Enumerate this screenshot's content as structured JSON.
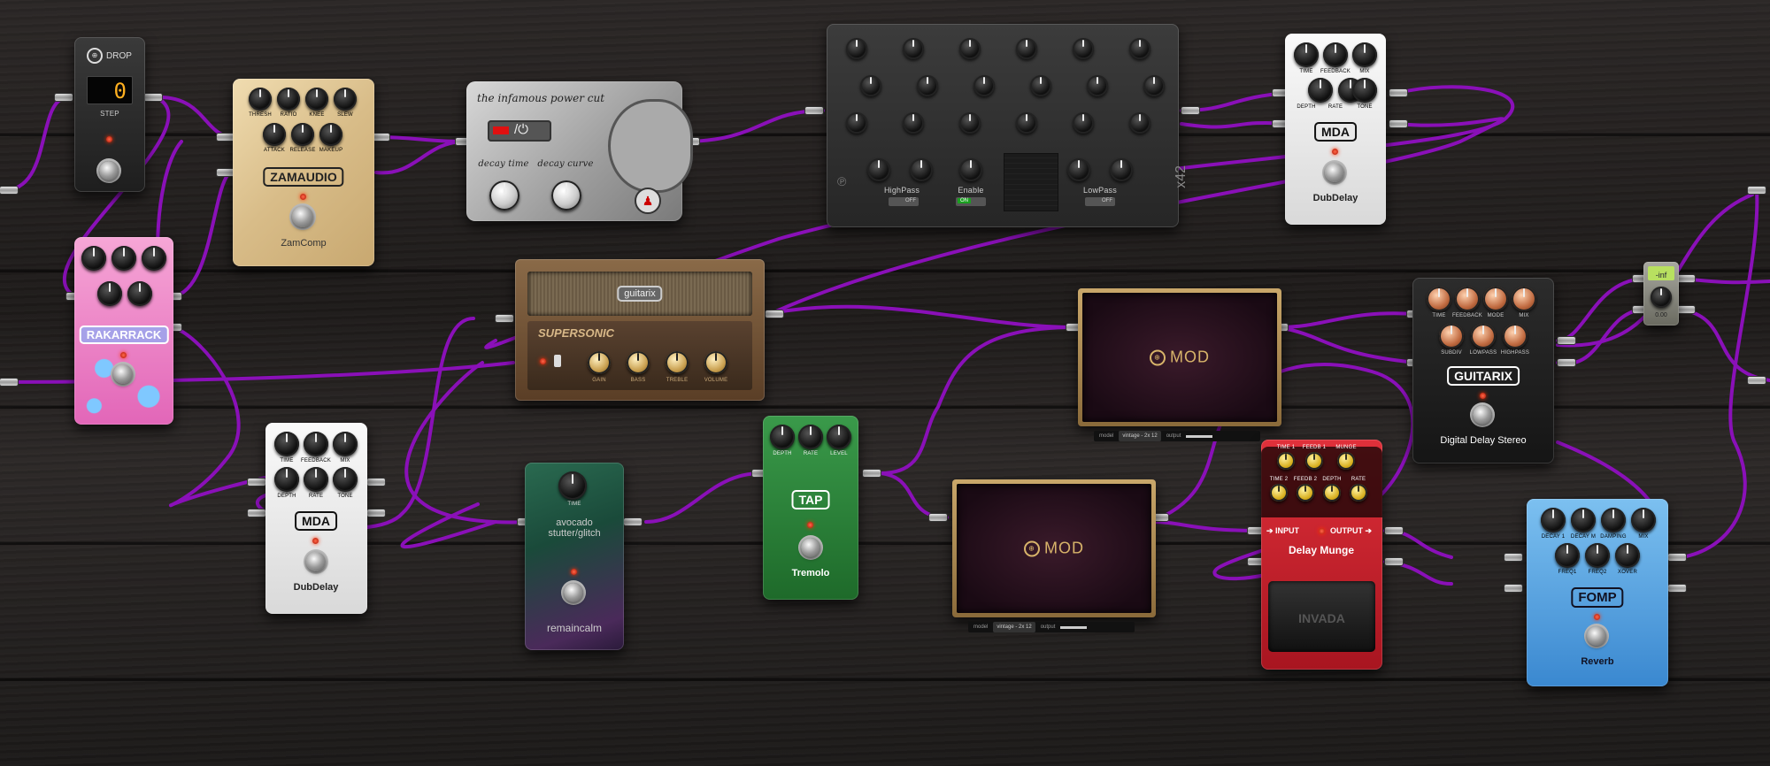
{
  "colors": {
    "cable": "#8a10b8",
    "cable_dark": "#5e0a80"
  },
  "drop": {
    "brand": "DROP",
    "value": "0",
    "label": "STEP"
  },
  "zamcomp": {
    "knobs": [
      "THRESH",
      "RATIO",
      "KNEE",
      "SLEW",
      "ATTACK",
      "RELEASE",
      "MAKEUP"
    ],
    "brand": "ZAMAUDIO",
    "name": "ZamComp"
  },
  "powercut": {
    "title": "the infamous power cut",
    "knob1": "decay time",
    "knob2": "decay curve"
  },
  "x42": {
    "brand": "x42",
    "highpass": "HighPass",
    "enable": "Enable",
    "lowpass": "LowPass",
    "off": "OFF",
    "on": "ON"
  },
  "mda_top": {
    "knobs": [
      "TIME",
      "FEEDBACK",
      "MIX",
      "DEPTH",
      "RATE",
      "TONE"
    ],
    "badge": "MDA",
    "name": "DubDelay"
  },
  "rakarrack": {
    "badge": "RAKARRACK"
  },
  "supersonic": {
    "logo": "guitarix",
    "name": "SUPERSONIC",
    "knobs": [
      "GAIN",
      "BASS",
      "TREBLE",
      "VOLUME"
    ]
  },
  "cab1": {
    "brand": "MOD",
    "model_label": "model",
    "model": "vintage - 2x 12",
    "output": "output"
  },
  "cab2": {
    "brand": "MOD",
    "model_label": "model",
    "model": "vintage - 2x 12",
    "output": "output"
  },
  "gx_delay": {
    "knobs": [
      "TIME",
      "FEEDBACK",
      "MODE",
      "MIX",
      "SUBDIV",
      "LOWPASS",
      "HIGHPASS"
    ],
    "badge": "GUITARIX",
    "name": "Digital Delay Stereo"
  },
  "gain_meter": {
    "value": "-inf",
    "sub": "0.00"
  },
  "mda_bottom": {
    "knobs": [
      "TIME",
      "FEEDBACK",
      "MIX",
      "DEPTH",
      "RATE",
      "TONE"
    ],
    "badge": "MDA",
    "name": "DubDelay"
  },
  "avocado": {
    "knob": "TIME",
    "name": "avocado stutter/glitch",
    "brand": "remaincalm"
  },
  "tremolo": {
    "knobs": [
      "DEPTH",
      "RATE",
      "LEVEL"
    ],
    "badge": "TAP",
    "name": "Tremolo"
  },
  "delaymunge": {
    "knobs": [
      "TIME 1",
      "FEEDB 1",
      "MUNGE",
      "TIME 2",
      "FEEDB 2",
      "DEPTH",
      "RATE"
    ],
    "input": "INPUT",
    "output": "OUTPUT",
    "name": "Delay Munge",
    "brand": "INVADA"
  },
  "reverb": {
    "knobs": [
      "DECAY 1",
      "DECAY M",
      "DAMPING",
      "MIX",
      "FREQ1",
      "FREQ2",
      "XOVER"
    ],
    "badge": "FOMP",
    "name": "Reverb"
  }
}
